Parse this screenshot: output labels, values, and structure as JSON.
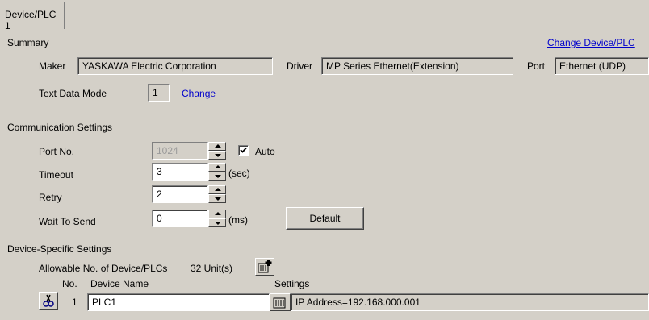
{
  "tab": {
    "label": "Device/PLC 1"
  },
  "summary": {
    "heading": "Summary",
    "change_device_link": "Change Device/PLC",
    "maker_label": "Maker",
    "maker_value": "YASKAWA Electric Corporation",
    "driver_label": "Driver",
    "driver_value": "MP Series Ethernet(Extension)",
    "port_label": "Port",
    "port_value": "Ethernet (UDP)",
    "text_data_mode_label": "Text Data Mode",
    "text_data_mode_value": "1",
    "change_link": "Change"
  },
  "comm": {
    "heading": "Communication Settings",
    "port_no_label": "Port No.",
    "port_no_value": "1024",
    "auto_label": "Auto",
    "auto_checked": true,
    "timeout_label": "Timeout",
    "timeout_value": "3",
    "timeout_unit": "(sec)",
    "retry_label": "Retry",
    "retry_value": "2",
    "wait_label": "Wait To Send",
    "wait_value": "0",
    "wait_unit": "(ms)",
    "default_button": "Default"
  },
  "device": {
    "heading": "Device-Specific Settings",
    "allowable_label": "Allowable No. of Device/PLCs",
    "allowable_value": "32 Unit(s)",
    "col_no": "No.",
    "col_device_name": "Device Name",
    "col_settings": "Settings",
    "rows": [
      {
        "no": "1",
        "name": "PLC1",
        "settings": "IP Address=192.168.000.001"
      }
    ]
  }
}
